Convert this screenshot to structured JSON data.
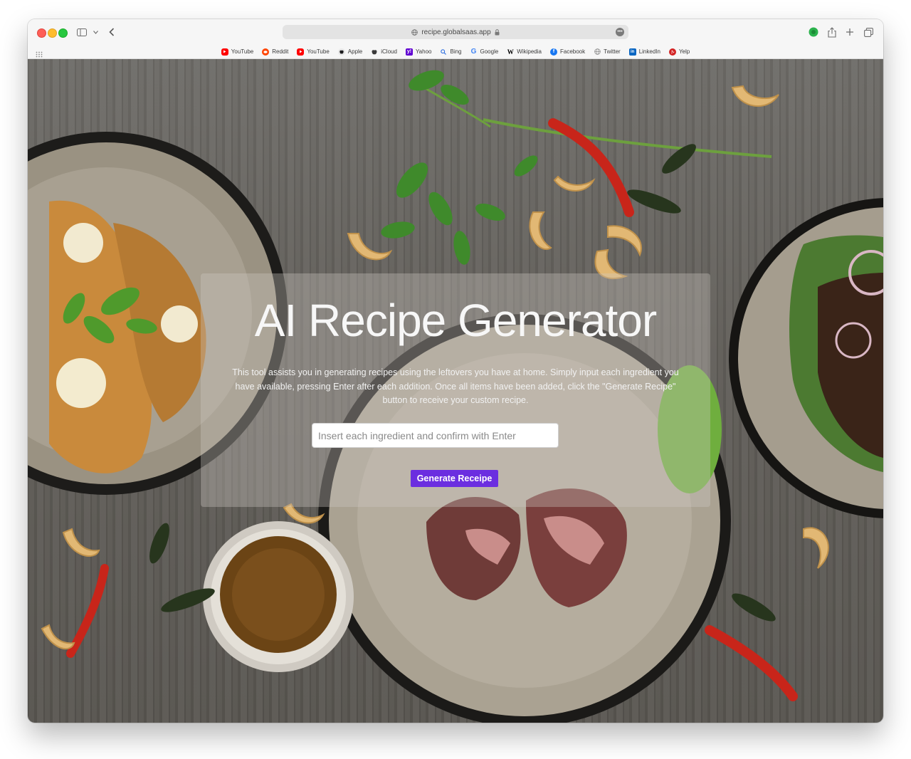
{
  "browser": {
    "url": "recipe.globalsaas.app",
    "favorites": [
      {
        "label": "YouTube",
        "icon": "youtube-icon",
        "color": "#ff0000"
      },
      {
        "label": "Reddit",
        "icon": "reddit-icon",
        "color": "#ff4500"
      },
      {
        "label": "YouTube",
        "icon": "youtube-icon",
        "color": "#ff0000"
      },
      {
        "label": "Apple",
        "icon": "apple-icon",
        "color": "#1d1d1f"
      },
      {
        "label": "iCloud",
        "icon": "apple-icon",
        "color": "#1d1d1f"
      },
      {
        "label": "Yahoo",
        "icon": "yahoo-icon",
        "color": "#6001d2"
      },
      {
        "label": "Bing",
        "icon": "search-icon",
        "color": "#2f6fe0"
      },
      {
        "label": "Google",
        "icon": "google-icon",
        "color": "#4285f4"
      },
      {
        "label": "Wikipedia",
        "icon": "wikipedia-icon",
        "color": "#000000"
      },
      {
        "label": "Facebook",
        "icon": "facebook-icon",
        "color": "#1877f2"
      },
      {
        "label": "Twitter",
        "icon": "globe-icon",
        "color": "#8a8a8a"
      },
      {
        "label": "LinkedIn",
        "icon": "linkedin-icon",
        "color": "#0a66c2"
      },
      {
        "label": "Yelp",
        "icon": "yelp-icon",
        "color": "#d32323"
      }
    ]
  },
  "hero": {
    "title": "AI Recipe Generator",
    "description": "This tool assists you in generating recipes using the leftovers you have at home. Simply input each ingredient you have available, pressing Enter after each addition. Once all items have been added, click the \"Generate Recipe\" button to receive your custom recipe.",
    "input_placeholder": "Insert each ingredient and confirm with Enter",
    "button_label": "Generate Receipe"
  },
  "colors": {
    "accent": "#6b2ee0"
  }
}
